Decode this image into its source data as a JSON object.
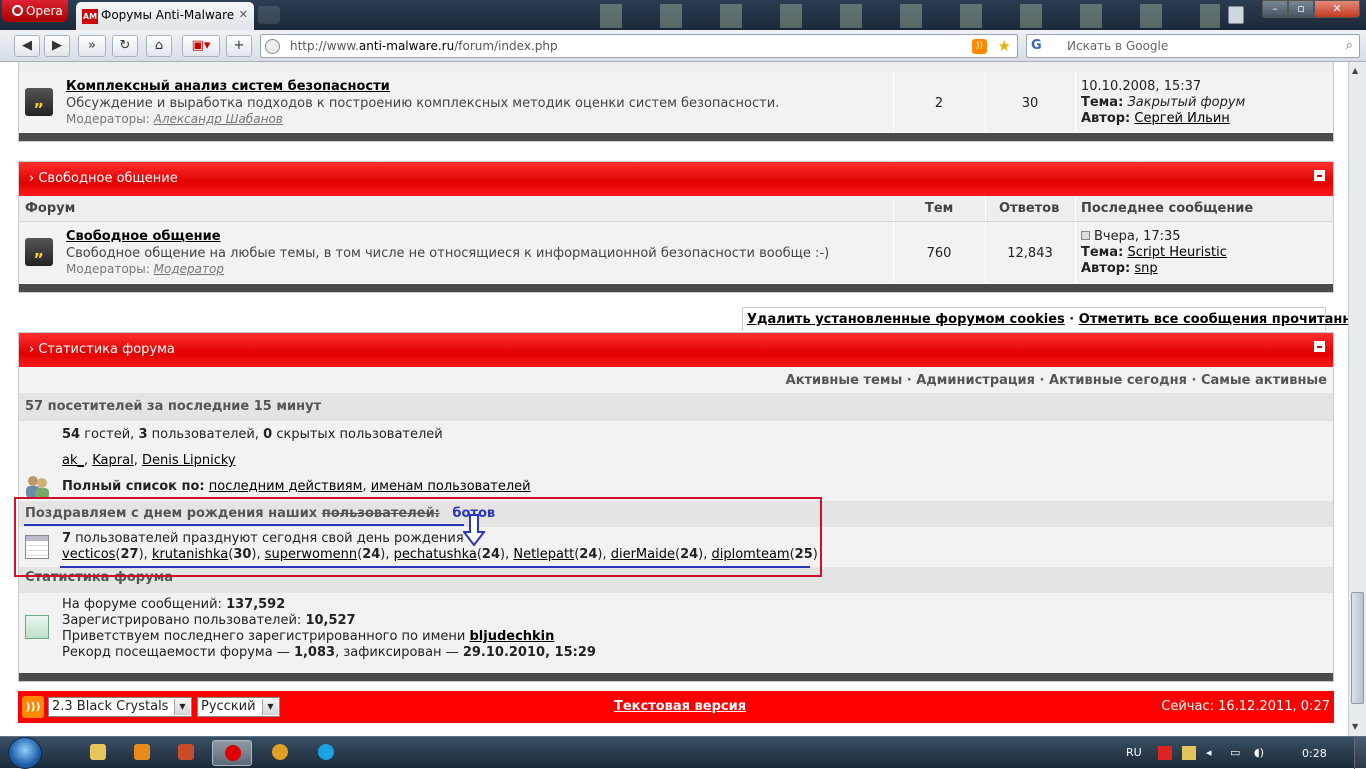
{
  "browser": {
    "opera_label": "Opera",
    "tab_title": "Форумы Anti-Malware",
    "tab_favicon": "AM",
    "url_prefix": "http://www.",
    "url_domain": "anti-malware.ru",
    "url_path": "/forum/index.php",
    "search_engine": "G",
    "search_placeholder": "Искать в Google"
  },
  "forum_complex": {
    "name": "Комплексный анализ систем безопасности",
    "description": "Обсуждение и выработка подходов к построению комплексных методик оценки систем безопасности.",
    "moderators_label": "Модераторы:",
    "moderator": "Александр Шабанов",
    "topics": "2",
    "replies": "30",
    "last_date": "10.10.2008, 15:37",
    "last_topic_label": "Тема:",
    "last_topic": "Закрытый форум",
    "last_author_label": "Автор:",
    "last_author": "Сергей Ильин"
  },
  "section_free": {
    "title": "Свободное общение",
    "col_forum": "Форум",
    "col_topics": "Тем",
    "col_replies": "Ответов",
    "col_last": "Последнее сообщение",
    "forum": {
      "name": "Свободное общение",
      "description": "Свободное общение на любые темы, в том числе не относящиеся к информационной безопасности вообще :-)",
      "moderators_label": "Модераторы:",
      "moderator": "Модератор",
      "topics": "760",
      "replies": "12,843",
      "last_date": "Вчера, 17:35",
      "last_topic_label": "Тема:",
      "last_topic": "Script Heuristic",
      "last_author_label": "Автор:",
      "last_author": "snp"
    }
  },
  "cookie_links": {
    "delete_cookies": "Удалить установленные форумом cookies",
    "separator": " · ",
    "mark_read": "Отметить все сообщения прочитанными"
  },
  "stats": {
    "title": "Статистика форума",
    "subnav": [
      "Активные темы",
      "Администрация",
      "Активные сегодня",
      "Самые активные"
    ],
    "visitors_head": "57 посетителей за последние 15 минут",
    "guests_num": "54",
    "guests_text": " гостей, ",
    "users_num": "3",
    "users_text": " пользователей, ",
    "hidden_num": "0",
    "hidden_text": " скрытых пользователей",
    "online_users": [
      "ak_",
      "Kapral",
      "Denis Lipnicky"
    ],
    "full_list_label": "Полный список по:",
    "full_list_links": [
      "последним действиям",
      "именам пользователей"
    ],
    "birthday_head": "Поздравляем с днем рождения наших",
    "birthday_struck": "пользователей:",
    "birthday_note": "ботов",
    "birthday_count": "7",
    "birthday_text": " пользователей празднуют сегодня свой день рождения",
    "birthday_users": [
      {
        "name": "vecticos",
        "age": "27"
      },
      {
        "name": "krutanishka",
        "age": "30"
      },
      {
        "name": "superwomenn",
        "age": "24"
      },
      {
        "name": "pechatushka",
        "age": "24"
      },
      {
        "name": "Netlepatt",
        "age": "24"
      },
      {
        "name": "dierMaide",
        "age": "24"
      },
      {
        "name": "diplomteam",
        "age": "25"
      }
    ],
    "stats_head": "Статистика форума",
    "posts_label": "На форуме сообщений: ",
    "posts_value": "137,592",
    "registered_label": "Зарегистрировано пользователей: ",
    "registered_value": "10,527",
    "welcome_label": "Приветствуем последнего зарегистрированного по имени ",
    "welcome_user": "bljudechkin",
    "record_label": "Рекорд посещаемости форума — ",
    "record_value": "1,083",
    "record_mid": ", зафиксирован — ",
    "record_date": "29.10.2010, 15:29"
  },
  "footer": {
    "skin": "2.3 Black Crystals",
    "language": "Русский",
    "text_version": "Текстовая версия",
    "now": "Сейчас: 16.12.2011, 0:27"
  },
  "taskbar": {
    "lang": "RU",
    "clock": "0:28"
  },
  "colors": {
    "forum_red": "#ff0000",
    "annotation_red": "#d0102a",
    "annotation_blue": "#2a36b8"
  }
}
